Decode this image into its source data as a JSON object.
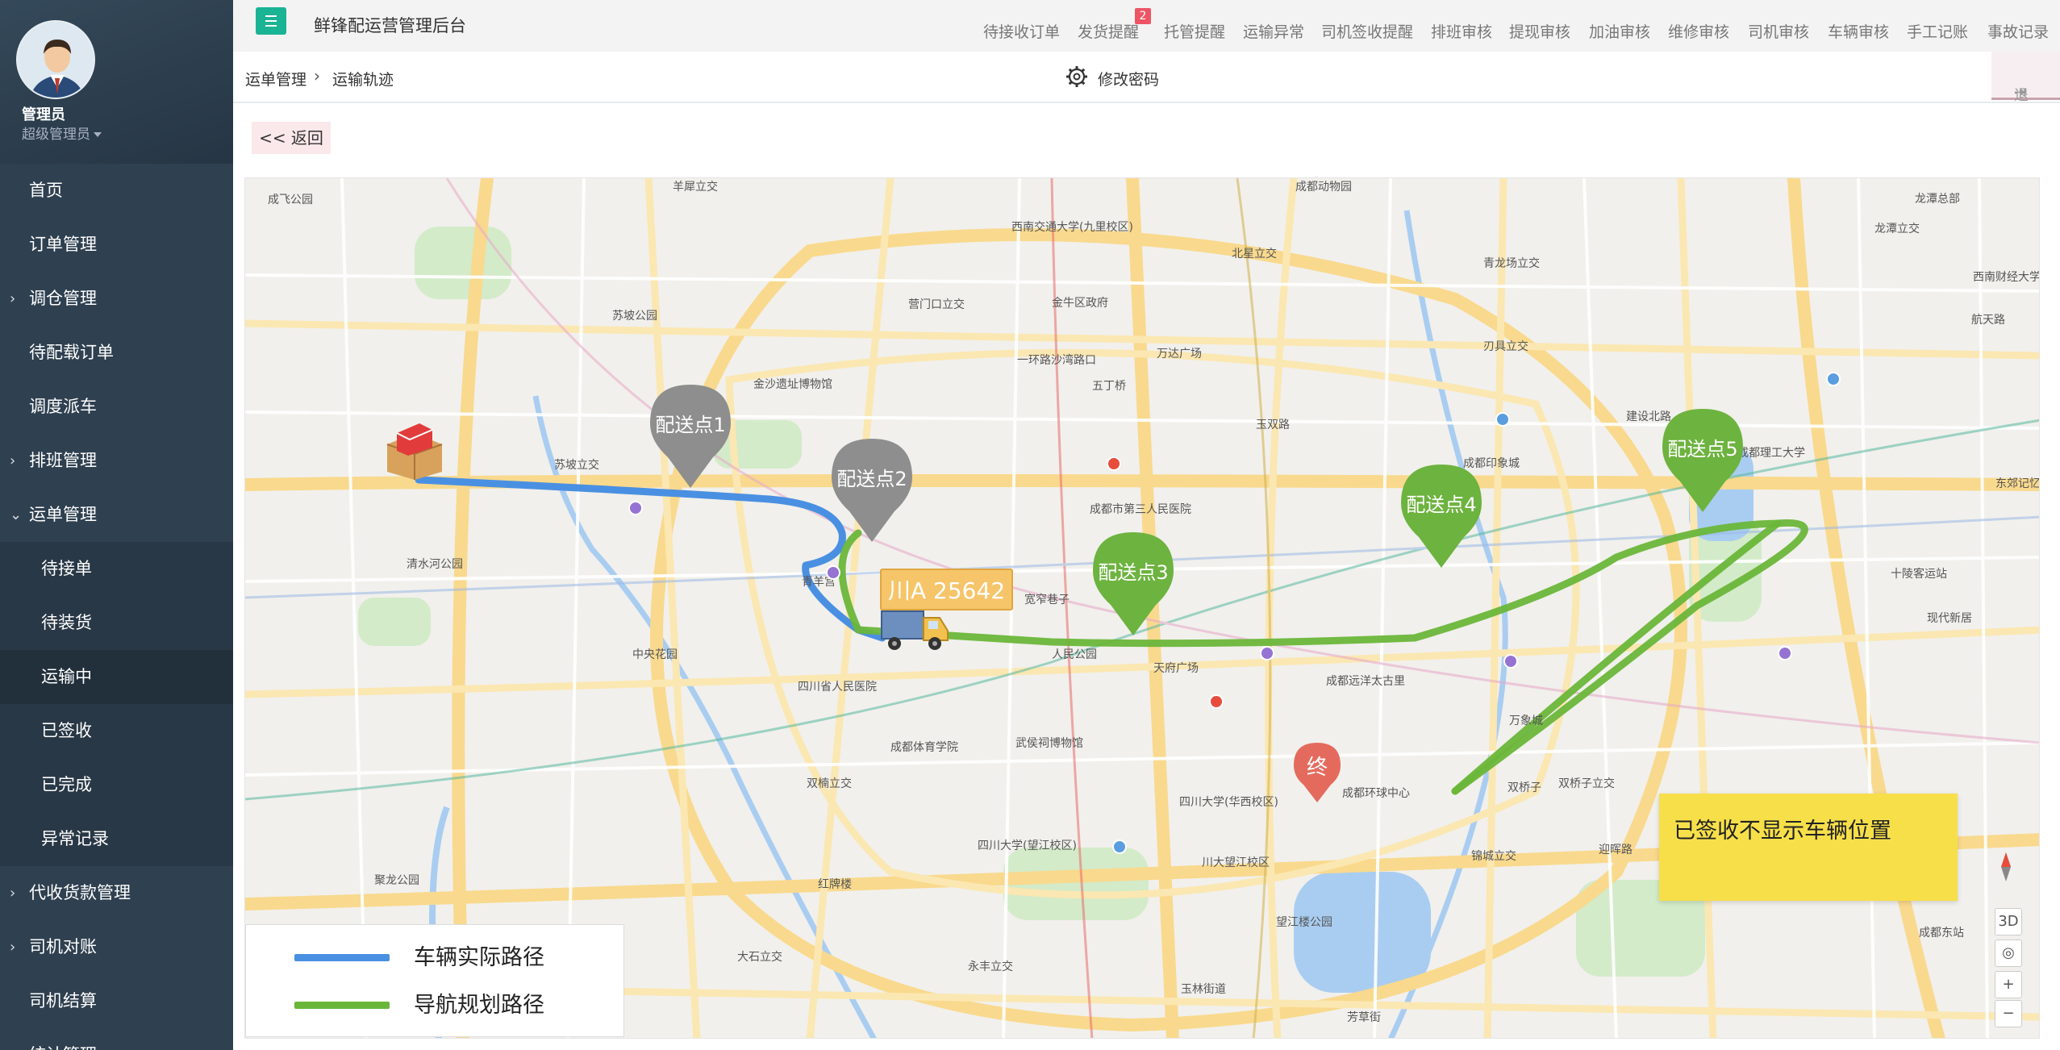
{
  "profile": {
    "name": "管理员",
    "role": "超级管理员"
  },
  "sidebar": {
    "items": [
      {
        "label": "首页",
        "kind": "top",
        "arrow": ""
      },
      {
        "label": "订单管理",
        "kind": "top",
        "arrow": ""
      },
      {
        "label": "调仓管理",
        "kind": "top",
        "arrow": "›"
      },
      {
        "label": "待配载订单",
        "kind": "top",
        "arrow": ""
      },
      {
        "label": "调度派车",
        "kind": "top",
        "arrow": ""
      },
      {
        "label": "排班管理",
        "kind": "top",
        "arrow": "›"
      },
      {
        "label": "运单管理",
        "kind": "top",
        "arrow": "⌄"
      },
      {
        "label": "待接单",
        "kind": "sub",
        "arrow": ""
      },
      {
        "label": "待装货",
        "kind": "sub",
        "arrow": ""
      },
      {
        "label": "运输中",
        "kind": "sub",
        "arrow": "",
        "active": true
      },
      {
        "label": "已签收",
        "kind": "sub",
        "arrow": ""
      },
      {
        "label": "已完成",
        "kind": "sub",
        "arrow": ""
      },
      {
        "label": "异常记录",
        "kind": "sub",
        "arrow": ""
      },
      {
        "label": "代收货款管理",
        "kind": "top",
        "arrow": "›"
      },
      {
        "label": "司机对账",
        "kind": "top",
        "arrow": "›"
      },
      {
        "label": "司机结算",
        "kind": "top",
        "arrow": ""
      },
      {
        "label": "统计管理",
        "kind": "top",
        "arrow": "›"
      }
    ]
  },
  "header": {
    "app_title": "鲜锋配运营管理后台",
    "alerts": [
      "待接收订单",
      "发货提醒",
      "托管提醒",
      "运输异常",
      "司机签收提醒",
      "排班审核",
      "提现审核",
      "加油审核",
      "维修审核",
      "司机审核",
      "车辆审核",
      "手工记账",
      "事故记录"
    ],
    "badge": "2",
    "change_password": "修改密码",
    "logout": "退出"
  },
  "breadcrumb": {
    "section": "运单管理",
    "page": "运输轨迹"
  },
  "back_button": "<< 返回",
  "map": {
    "pins": [
      {
        "label": "配送点1",
        "color": "#8e8e8e"
      },
      {
        "label": "配送点2",
        "color": "#8e8e8e"
      },
      {
        "label": "配送点3",
        "color": "#6db33f"
      },
      {
        "label": "配送点4",
        "color": "#6db33f"
      },
      {
        "label": "配送点5",
        "color": "#6db33f"
      }
    ],
    "end_marker": "终",
    "vehicle_plate": "川A 25642",
    "notice": "已签收不显示车辆位置",
    "legend": {
      "actual": "车辆实际路径",
      "planned": "导航规划路径"
    },
    "legend_colors": {
      "actual": "#4a90e2",
      "planned": "#6ab63a"
    },
    "controls": {
      "three_d": "3D",
      "zoom_in": "+",
      "zoom_out": "−"
    },
    "places": [
      "羊犀立交",
      "成飞公园",
      "西南交通大学(九里校区)",
      "北星立交",
      "成都动物园",
      "青龙场立交",
      "龙潭立交",
      "龙潭总部",
      "苏坡公园",
      "营门口立交",
      "金牛区政府",
      "刃具立交",
      "西南财经大学天府学院",
      "航天路",
      "金沙遗址博物馆",
      "一环路沙湾路口",
      "五丁桥",
      "玉双路",
      "万达广场",
      "成都印象城",
      "苏坡立交",
      "宽窄巷子",
      "成都理工大学",
      "成都东站",
      "四川省人民医院",
      "成都市第三人民医院",
      "人民公园",
      "青羊宫",
      "天府广场",
      "成都远洋太古里",
      "双桥子立交",
      "成都体育学院",
      "四川大学(华西校区)",
      "川大望江校区",
      "望江楼公园",
      "四川大学(望江校区)",
      "玉林街道",
      "双楠立交",
      "武侯祠博物馆",
      "锦城立交",
      "永丰立交",
      "红牌楼",
      "芳草街",
      "中央花园",
      "清水河公园",
      "大石立交",
      "聚龙公园",
      "现代新居",
      "十陵客运站",
      "万象城",
      "成都环球中心",
      "迎晖路",
      "双桥子",
      "建设北路",
      "东郊记忆"
    ]
  }
}
